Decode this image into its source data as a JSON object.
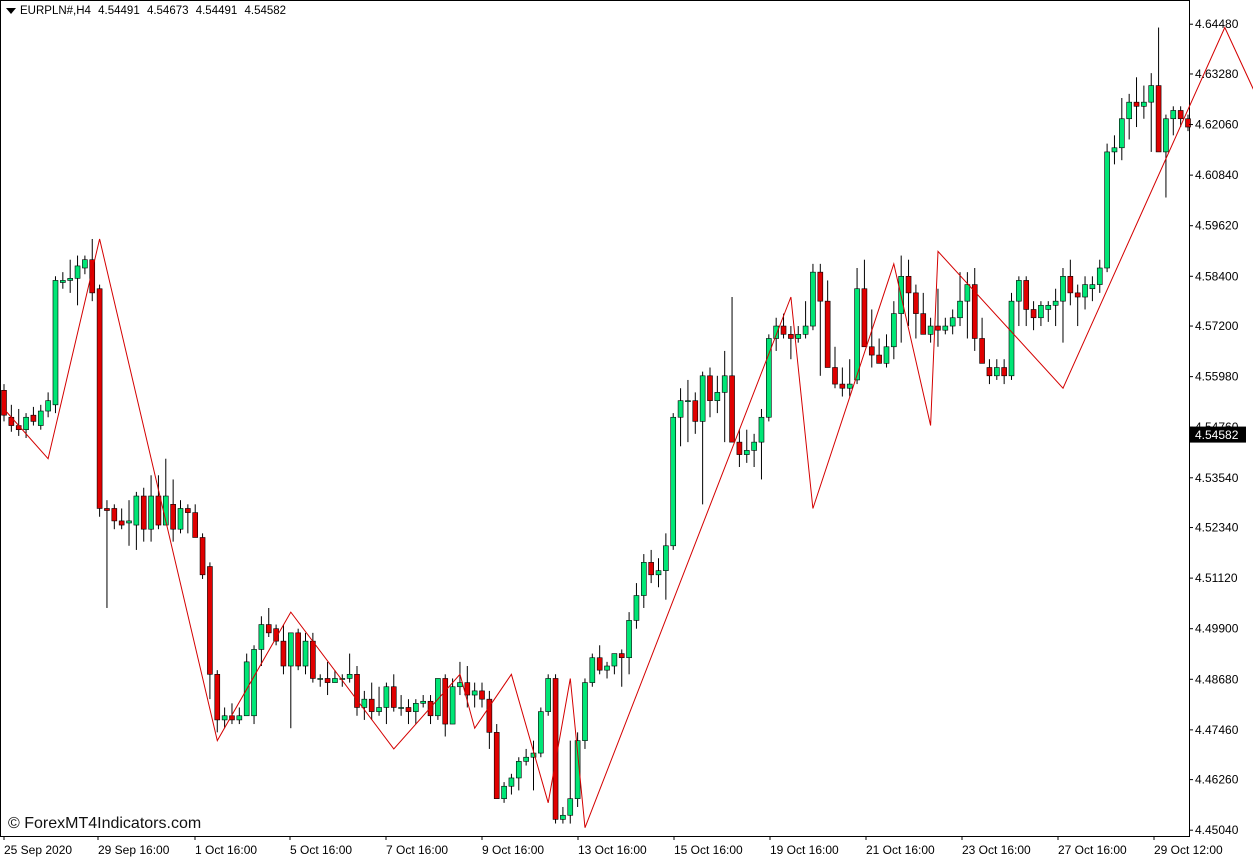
{
  "header": {
    "symbol": "EURPLN#,H4",
    "open": "4.54491",
    "high": "4.54673",
    "low": "4.54491",
    "close": "4.54582"
  },
  "watermark": "© ForexMT4Indicators.com",
  "colors": {
    "bull": "#00e676",
    "bear": "#e00000",
    "wick": "#000000",
    "zigzag": "#d40000",
    "price_tag_bg": "#000000",
    "price_tag_text": "#ffffff"
  },
  "chart_data": {
    "type": "candlestick",
    "ylim": [
      4.449,
      4.6504
    ],
    "y_ticks": [
      "4.64480",
      "4.63280",
      "4.62060",
      "4.60840",
      "4.59620",
      "4.58400",
      "4.57200",
      "4.55980",
      "4.54760",
      "4.53540",
      "4.52340",
      "4.51120",
      "4.49900",
      "4.48680",
      "4.47460",
      "4.46260",
      "4.45040"
    ],
    "x_labels": [
      "25 Sep 2020",
      "29 Sep 16:00",
      "1 Oct 16:00",
      "5 Oct 16:00",
      "7 Oct 16:00",
      "9 Oct 16:00",
      "13 Oct 16:00",
      "15 Oct 16:00",
      "19 Oct 16:00",
      "21 Oct 16:00",
      "23 Oct 16:00",
      "27 Oct 16:00",
      "29 Oct 12:00"
    ],
    "current_price": "4.54582",
    "candles": [
      [
        4.5565,
        4.558,
        4.549,
        4.5505
      ],
      [
        4.55,
        4.553,
        4.5465,
        4.548
      ],
      [
        4.548,
        4.552,
        4.5455,
        4.547
      ],
      [
        4.547,
        4.551,
        4.545,
        4.55
      ],
      [
        4.5505,
        4.5525,
        4.548,
        4.549
      ],
      [
        4.548,
        4.553,
        4.547,
        4.5515
      ],
      [
        4.5515,
        4.556,
        4.55,
        4.554
      ],
      [
        4.553,
        4.584,
        4.551,
        4.583
      ],
      [
        4.5825,
        4.585,
        4.581,
        4.583
      ],
      [
        4.583,
        4.588,
        4.58,
        4.5835
      ],
      [
        4.5835,
        4.589,
        4.577,
        4.5865
      ],
      [
        4.586,
        4.589,
        4.5845,
        4.588
      ],
      [
        4.588,
        4.593,
        4.578,
        4.58
      ],
      [
        4.581,
        4.582,
        4.526,
        4.528
      ],
      [
        4.528,
        4.53,
        4.504,
        4.5275
      ],
      [
        4.528,
        4.529,
        4.523,
        4.525
      ],
      [
        4.525,
        4.528,
        4.523,
        4.524
      ],
      [
        4.5245,
        4.53,
        4.519,
        4.525
      ],
      [
        4.524,
        4.532,
        4.518,
        4.531
      ],
      [
        4.531,
        4.533,
        4.52,
        4.523
      ],
      [
        4.523,
        4.536,
        4.52,
        4.531
      ],
      [
        4.531,
        4.536,
        4.523,
        4.524
      ],
      [
        4.524,
        4.54,
        4.524,
        4.531
      ],
      [
        4.529,
        4.535,
        4.52,
        4.523
      ],
      [
        4.523,
        4.53,
        4.522,
        4.528
      ],
      [
        4.528,
        4.529,
        4.522,
        4.527
      ],
      [
        4.527,
        4.529,
        4.521,
        4.521
      ],
      [
        4.521,
        4.522,
        4.511,
        4.512
      ],
      [
        4.514,
        4.515,
        4.482,
        4.488
      ],
      [
        4.488,
        4.489,
        4.474,
        4.477
      ],
      [
        4.477,
        4.48,
        4.475,
        4.478
      ],
      [
        4.478,
        4.481,
        4.476,
        4.477
      ],
      [
        4.477,
        4.48,
        4.476,
        4.478
      ],
      [
        4.478,
        4.493,
        4.478,
        4.491
      ],
      [
        4.478,
        4.495,
        4.476,
        4.494
      ],
      [
        4.494,
        4.502,
        4.49,
        4.5
      ],
      [
        4.5,
        4.504,
        4.497,
        4.498
      ],
      [
        4.499,
        4.5,
        4.495,
        4.496
      ],
      [
        4.496,
        4.5,
        4.488,
        4.49
      ],
      [
        4.49,
        4.498,
        4.475,
        4.498
      ],
      [
        4.498,
        4.499,
        4.489,
        4.49
      ],
      [
        4.49,
        4.498,
        4.488,
        4.496
      ],
      [
        4.496,
        4.498,
        4.486,
        4.487
      ],
      [
        4.487,
        4.488,
        4.485,
        4.487
      ],
      [
        4.487,
        4.491,
        4.483,
        4.486
      ],
      [
        4.486,
        4.489,
        4.486,
        4.487
      ],
      [
        4.487,
        4.488,
        4.485,
        4.487
      ],
      [
        4.487,
        4.493,
        4.486,
        4.488
      ],
      [
        4.488,
        4.49,
        4.478,
        4.48
      ],
      [
        4.48,
        4.484,
        4.477,
        4.482
      ],
      [
        4.482,
        4.486,
        4.477,
        4.479
      ],
      [
        4.479,
        4.485,
        4.478,
        4.48
      ],
      [
        4.48,
        4.486,
        4.476,
        4.485
      ],
      [
        4.485,
        4.488,
        4.479,
        4.48
      ],
      [
        4.48,
        4.483,
        4.478,
        4.48
      ],
      [
        4.48,
        4.482,
        4.476,
        4.479
      ],
      [
        4.479,
        4.482,
        4.476,
        4.481
      ],
      [
        4.481,
        4.483,
        4.48,
        4.4815
      ],
      [
        4.4815,
        4.483,
        4.476,
        4.478
      ],
      [
        4.478,
        4.487,
        4.477,
        4.487
      ],
      [
        4.487,
        4.488,
        4.473,
        4.476
      ],
      [
        4.476,
        4.487,
        4.476,
        4.485
      ],
      [
        4.485,
        4.491,
        4.483,
        4.486
      ],
      [
        4.486,
        4.49,
        4.48,
        4.483
      ],
      [
        4.483,
        4.486,
        4.48,
        4.484
      ],
      [
        4.484,
        4.486,
        4.48,
        4.482
      ],
      [
        4.482,
        4.484,
        4.47,
        4.474
      ],
      [
        4.474,
        4.476,
        4.458,
        4.458
      ],
      [
        4.458,
        4.462,
        4.457,
        4.461
      ],
      [
        4.461,
        4.464,
        4.459,
        4.463
      ],
      [
        4.463,
        4.468,
        4.46,
        4.467
      ],
      [
        4.467,
        4.47,
        4.466,
        4.468
      ],
      [
        4.468,
        4.472,
        4.46,
        4.469
      ],
      [
        4.469,
        4.48,
        4.468,
        4.479
      ],
      [
        4.479,
        4.488,
        4.478,
        4.487
      ],
      [
        4.487,
        4.488,
        4.452,
        4.453
      ],
      [
        4.453,
        4.456,
        4.452,
        4.454
      ],
      [
        4.454,
        4.472,
        4.452,
        4.458
      ],
      [
        4.458,
        4.474,
        4.456,
        4.472
      ],
      [
        4.472,
        4.487,
        4.47,
        4.486
      ],
      [
        4.486,
        4.493,
        4.485,
        4.492
      ],
      [
        4.492,
        4.495,
        4.488,
        4.489
      ],
      [
        4.489,
        4.491,
        4.487,
        4.49
      ],
      [
        4.49,
        4.493,
        4.488,
        4.493
      ],
      [
        4.493,
        4.494,
        4.485,
        4.492
      ],
      [
        4.492,
        4.503,
        4.488,
        4.501
      ],
      [
        4.501,
        4.51,
        4.499,
        4.507
      ],
      [
        4.507,
        4.517,
        4.504,
        4.515
      ],
      [
        4.515,
        4.518,
        4.51,
        4.512
      ],
      [
        4.512,
        4.516,
        4.509,
        4.513
      ],
      [
        4.513,
        4.522,
        4.506,
        4.519
      ],
      [
        4.519,
        4.551,
        4.518,
        4.55
      ],
      [
        4.55,
        4.557,
        4.543,
        4.554
      ],
      [
        4.554,
        4.559,
        4.544,
        4.554
      ],
      [
        4.554,
        4.556,
        4.546,
        4.549
      ],
      [
        4.549,
        4.561,
        4.529,
        4.56
      ],
      [
        4.56,
        4.562,
        4.55,
        4.554
      ],
      [
        4.554,
        4.56,
        4.551,
        4.556
      ],
      [
        4.556,
        4.566,
        4.544,
        4.56
      ],
      [
        4.56,
        4.579,
        4.545,
        4.544
      ],
      [
        4.544,
        4.547,
        4.538,
        4.541
      ],
      [
        4.541,
        4.547,
        4.539,
        4.542
      ],
      [
        4.542,
        4.546,
        4.538,
        4.544
      ],
      [
        4.544,
        4.552,
        4.535,
        4.55
      ],
      [
        4.55,
        4.57,
        4.549,
        4.569
      ],
      [
        4.569,
        4.574,
        4.566,
        4.572
      ],
      [
        4.572,
        4.575,
        4.569,
        4.57
      ],
      [
        4.57,
        4.572,
        4.564,
        4.569
      ],
      [
        4.569,
        4.572,
        4.568,
        4.57
      ],
      [
        4.57,
        4.578,
        4.569,
        4.572
      ],
      [
        4.572,
        4.587,
        4.571,
        4.585
      ],
      [
        4.585,
        4.587,
        4.56,
        4.578
      ],
      [
        4.578,
        4.583,
        4.562,
        4.562
      ],
      [
        4.562,
        4.567,
        4.557,
        4.558
      ],
      [
        4.558,
        4.562,
        4.555,
        4.557
      ],
      [
        4.557,
        4.564,
        4.555,
        4.558
      ],
      [
        4.559,
        4.586,
        4.558,
        4.581
      ],
      [
        4.581,
        4.588,
        4.567,
        4.567
      ],
      [
        4.567,
        4.576,
        4.562,
        4.565
      ],
      [
        4.565,
        4.569,
        4.563,
        4.563
      ],
      [
        4.563,
        4.57,
        4.562,
        4.567
      ],
      [
        4.567,
        4.578,
        4.564,
        4.575
      ],
      [
        4.575,
        4.589,
        4.568,
        4.584
      ],
      [
        4.584,
        4.588,
        4.572,
        4.58
      ],
      [
        4.58,
        4.582,
        4.569,
        4.575
      ],
      [
        4.575,
        4.58,
        4.57,
        4.57
      ],
      [
        4.57,
        4.574,
        4.568,
        4.572
      ],
      [
        4.572,
        4.581,
        4.567,
        4.571
      ],
      [
        4.571,
        4.574,
        4.57,
        4.572
      ],
      [
        4.572,
        4.576,
        4.57,
        4.574
      ],
      [
        4.574,
        4.585,
        4.572,
        4.578
      ],
      [
        4.578,
        4.585,
        4.569,
        4.582
      ],
      [
        4.582,
        4.586,
        4.566,
        4.569
      ],
      [
        4.569,
        4.574,
        4.564,
        4.563
      ],
      [
        4.562,
        4.564,
        4.558,
        4.56
      ],
      [
        4.56,
        4.564,
        4.559,
        4.562
      ],
      [
        4.562,
        4.564,
        4.558,
        4.56
      ],
      [
        4.56,
        4.58,
        4.559,
        4.578
      ],
      [
        4.578,
        4.584,
        4.572,
        4.583
      ],
      [
        4.583,
        4.584,
        4.572,
        4.576
      ],
      [
        4.576,
        4.578,
        4.571,
        4.574
      ],
      [
        4.574,
        4.578,
        4.572,
        4.577
      ],
      [
        4.576,
        4.578,
        4.573,
        4.577
      ],
      [
        4.577,
        4.581,
        4.572,
        4.578
      ],
      [
        4.578,
        4.586,
        4.568,
        4.584
      ],
      [
        4.584,
        4.588,
        4.577,
        4.58
      ],
      [
        4.58,
        4.582,
        4.572,
        4.579
      ],
      [
        4.579,
        4.584,
        4.576,
        4.582
      ],
      [
        4.581,
        4.584,
        4.578,
        4.582
      ],
      [
        4.582,
        4.588,
        4.58,
        4.586
      ],
      [
        4.586,
        4.616,
        4.585,
        4.614
      ],
      [
        4.614,
        4.618,
        4.611,
        4.615
      ],
      [
        4.615,
        4.627,
        4.612,
        4.622
      ],
      [
        4.622,
        4.628,
        4.617,
        4.626
      ],
      [
        4.626,
        4.632,
        4.62,
        4.625
      ],
      [
        4.625,
        4.63,
        4.622,
        4.626
      ],
      [
        4.626,
        4.633,
        4.614,
        4.63
      ],
      [
        4.63,
        4.644,
        4.618,
        4.614
      ],
      [
        4.614,
        4.623,
        4.603,
        4.622
      ],
      [
        4.622,
        4.625,
        4.618,
        4.624
      ],
      [
        4.624,
        4.625,
        4.62,
        4.622
      ],
      [
        4.622,
        4.623,
        4.619,
        4.62
      ]
    ],
    "zigzag": [
      [
        0,
        4.552
      ],
      [
        6,
        4.54
      ],
      [
        13,
        4.593
      ],
      [
        29,
        4.472
      ],
      [
        39,
        4.503
      ],
      [
        53,
        4.47
      ],
      [
        62,
        4.488
      ],
      [
        64,
        4.475
      ],
      [
        69,
        4.488
      ],
      [
        74,
        4.457
      ],
      [
        77,
        4.487
      ],
      [
        79,
        4.451
      ],
      [
        107,
        4.579
      ],
      [
        110,
        4.528
      ],
      [
        121,
        4.587
      ],
      [
        126,
        4.548
      ],
      [
        127,
        4.59
      ],
      [
        144,
        4.557
      ],
      [
        166,
        4.644
      ],
      [
        172,
        4.621
      ]
    ]
  }
}
